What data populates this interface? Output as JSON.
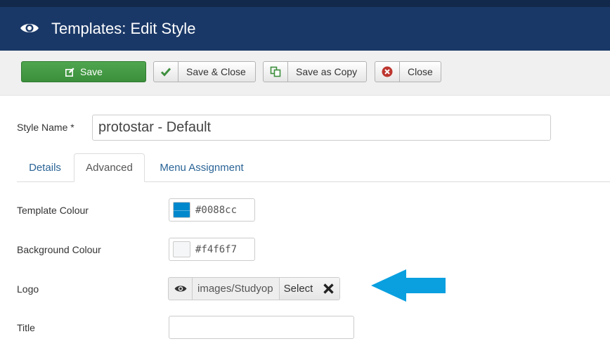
{
  "header": {
    "title": "Templates: Edit Style",
    "icon": "eye-icon"
  },
  "toolbar": {
    "save_label": "Save",
    "save_close_label": "Save & Close",
    "save_copy_label": "Save as Copy",
    "close_label": "Close"
  },
  "style": {
    "label": "Style Name *",
    "value": "protostar - Default"
  },
  "tabs": [
    {
      "label": "Details",
      "active": false
    },
    {
      "label": "Advanced",
      "active": true
    },
    {
      "label": "Menu Assignment",
      "active": false
    }
  ],
  "fields": {
    "template_colour": {
      "label": "Template Colour",
      "value": "#0088cc",
      "swatch": "#0088cc"
    },
    "background_colour": {
      "label": "Background Colour",
      "value": "#f4f6f7",
      "swatch": "#f4f6f7"
    },
    "logo": {
      "label": "Logo",
      "value": "images/Studyop",
      "select_label": "Select"
    },
    "title": {
      "label": "Title",
      "value": ""
    }
  },
  "colors": {
    "header_bg": "#1a3867",
    "save_green": "#46a546",
    "arrow_blue": "#0aa0e0",
    "link_blue": "#2a6496"
  }
}
